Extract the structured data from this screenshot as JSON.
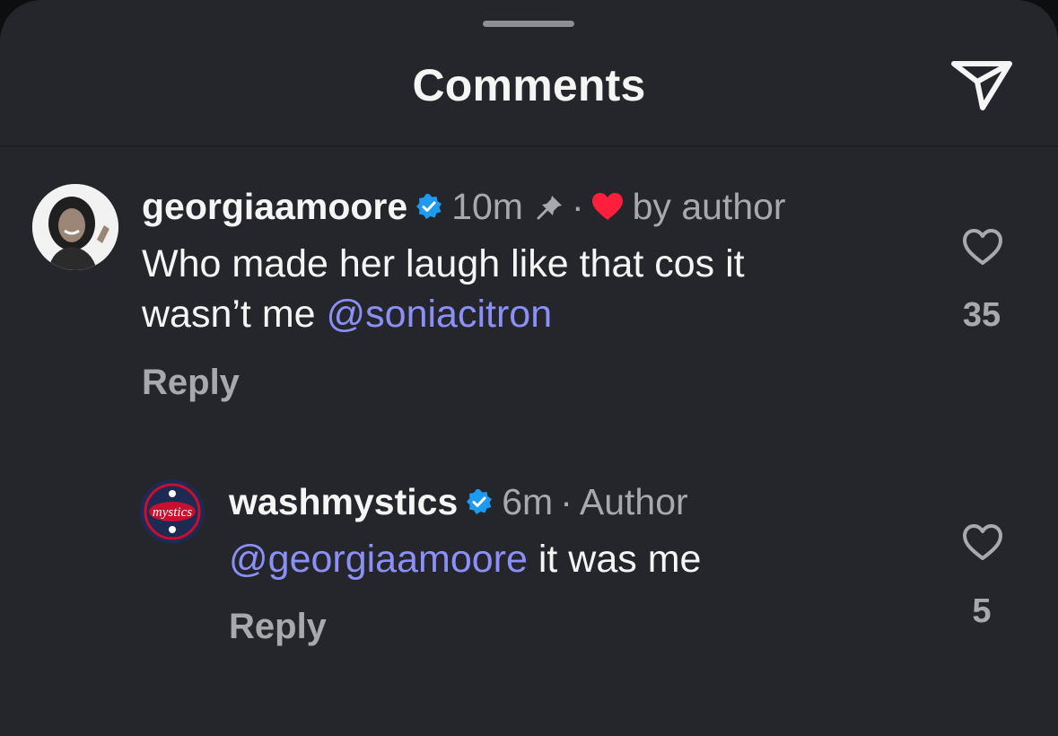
{
  "header": {
    "title": "Comments",
    "share_icon": "paper-plane-icon"
  },
  "colors": {
    "background": "#25262b",
    "text": "#f5f5f5",
    "muted": "#a8a9ad",
    "mention": "#8c8ff5",
    "verified": "#1d9bf0",
    "heart": "#ff1f3d"
  },
  "comments": [
    {
      "username": "georgiaamoore",
      "verified": true,
      "time": "10m",
      "pinned": true,
      "dot": "·",
      "liked_by_author_label": "by author",
      "text": "Who made her laugh like that cos it\nwasn’t me ",
      "mention": "@soniacitron",
      "reply_label": "Reply",
      "likes": "35"
    },
    {
      "username": "washmystics",
      "verified": true,
      "time": "6m",
      "dot": "·",
      "role": "Author",
      "mention": "@georgiaamoore",
      "text": " it was me",
      "reply_label": "Reply",
      "likes": "5",
      "avatar_logo_text": "mystics"
    }
  ]
}
